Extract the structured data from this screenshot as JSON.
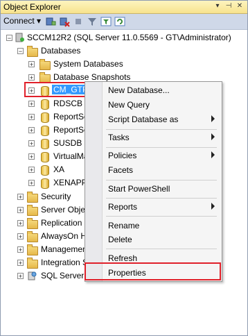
{
  "title_bar": {
    "title": "Object Explorer",
    "pin_glyph": "▾",
    "pushpin_glyph": "⊣",
    "close_glyph": "✕"
  },
  "toolbar": {
    "connect_label": "Connect ▾"
  },
  "tree": {
    "server": "SCCM12R2 (SQL Server 11.0.5569 - GT\\Administrator)",
    "databases": "Databases",
    "system_databases": "System Databases",
    "database_snapshots": "Database Snapshots",
    "db_items": [
      "CM_GTP",
      "RDSCB",
      "ReportSe",
      "ReportSe",
      "SUSDB",
      "VirtualMa",
      "XA",
      "XENAPP"
    ],
    "security": "Security",
    "server_objects": "Server Objec",
    "replication": "Replication",
    "alwayson": "AlwaysOn H",
    "management": "Managemen",
    "integration": "Integration S",
    "sql_agent": "SQL Server A"
  },
  "context_menu": {
    "new_database": "New Database...",
    "new_query": "New Query",
    "script_database_as": "Script Database as",
    "tasks": "Tasks",
    "policies": "Policies",
    "facets": "Facets",
    "start_powershell": "Start PowerShell",
    "reports": "Reports",
    "rename": "Rename",
    "delete": "Delete",
    "refresh": "Refresh",
    "properties": "Properties"
  },
  "colors": {
    "highlight_box": "#e0202a",
    "selection": "#3399ff",
    "titlebar": "#f7e38d"
  }
}
